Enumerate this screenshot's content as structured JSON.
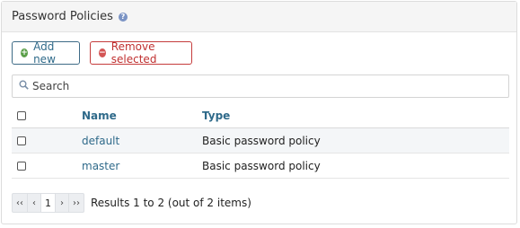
{
  "panel": {
    "title": "Password Policies",
    "help_icon": "?"
  },
  "toolbar": {
    "add_label": "Add new",
    "add_icon": "plus-circle-icon",
    "remove_label": "Remove selected",
    "remove_icon": "minus-circle-icon"
  },
  "search": {
    "placeholder": "Search",
    "value": ""
  },
  "table": {
    "columns": [
      "Name",
      "Type"
    ],
    "rows": [
      {
        "name": "default",
        "type": "Basic password policy"
      },
      {
        "name": "master",
        "type": "Basic password policy"
      }
    ]
  },
  "pager": {
    "first": "‹‹",
    "prev": "‹",
    "page": "1",
    "next": "›",
    "last": "››",
    "info": "Results 1 to 2 (out of 2 items)"
  },
  "colors": {
    "accent": "#2f6a8a",
    "add_border": "#3e6b86",
    "remove": "#c03030",
    "add_icon": "#5a9e48",
    "remove_icon": "#d45555"
  }
}
